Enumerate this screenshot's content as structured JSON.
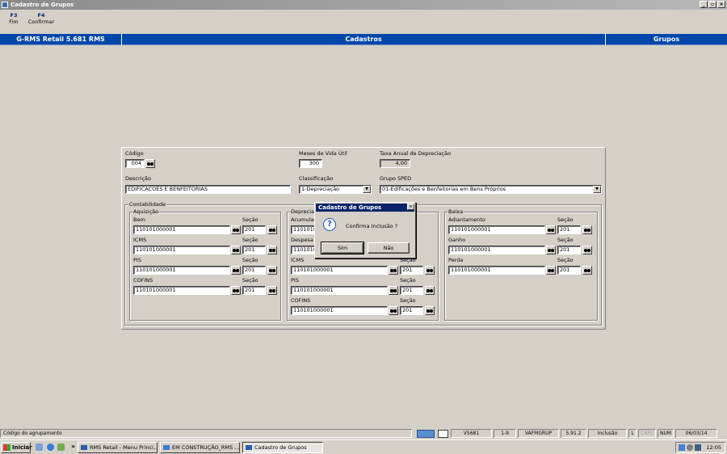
{
  "window": {
    "title": "Cadastro de Grupos",
    "controls": [
      "_",
      "▫",
      "×"
    ]
  },
  "fkeys": [
    {
      "key": "F3",
      "label": "Fim"
    },
    {
      "key": "F4",
      "label": "Confirmar"
    }
  ],
  "header": {
    "app": "G-RMS Retail 5.681 RMS",
    "module": "Cadastros",
    "screen": "Grupos"
  },
  "form": {
    "codigo": {
      "label": "Código",
      "value": "004"
    },
    "meses": {
      "label": "Meses de Vida Útil",
      "value": "300"
    },
    "taxa": {
      "label": "Taxa Anual de Depreciação",
      "value": "4,00"
    },
    "descricao": {
      "label": "Descrição",
      "value": "EDIFICACOES E BENFEITORIAS"
    },
    "classificacao": {
      "label": "Classificação",
      "value": "1-Depreciação"
    },
    "grupo_sped": {
      "label": "Grupo SPED",
      "value": "01-Edificações e Benfeitorias em Bens Próprios"
    }
  },
  "contabilidade": {
    "title": "Contabilidade",
    "aquisicao": {
      "title": "Aquisição",
      "rows": [
        {
          "label": "Bem",
          "value": "110101000001",
          "secao_label": "Seção",
          "secao": "201"
        },
        {
          "label": "ICMS",
          "value": "110101000001",
          "secao_label": "Seção",
          "secao": "201"
        },
        {
          "label": "PIS",
          "value": "110101000001",
          "secao_label": "Seção",
          "secao": "201"
        },
        {
          "label": "COFINS",
          "value": "110101000001",
          "secao_label": "Seção",
          "secao": "201"
        }
      ]
    },
    "depreciacao": {
      "title": "Deprecia",
      "rows": [
        {
          "label": "Acumulad",
          "value": "11010100",
          "secao_label": "",
          "secao": ""
        },
        {
          "label": "Despesa",
          "value": "11010100",
          "secao_label": "",
          "secao": ""
        },
        {
          "label": "ICMS",
          "value": "110101000001",
          "secao_label": "Seção",
          "secao": "201"
        },
        {
          "label": "PIS",
          "value": "110101000001",
          "secao_label": "Seção",
          "secao": "201"
        },
        {
          "label": "COFINS",
          "value": "110101000001",
          "secao_label": "Seção",
          "secao": "201"
        }
      ]
    },
    "baixa": {
      "title": "Baixa",
      "rows": [
        {
          "label": "Adiantamento",
          "value": "110101000001",
          "secao_label": "Seção",
          "secao": "201"
        },
        {
          "label": "Ganho",
          "value": "110101000001",
          "secao_label": "Seção",
          "secao": "201"
        },
        {
          "label": "Perda",
          "value": "110101000001",
          "secao_label": "Seção",
          "secao": "201"
        }
      ]
    }
  },
  "dialog": {
    "title": "Cadastro de Grupos",
    "close": "×",
    "message": "Confirma Inclusão ?",
    "icon": "?",
    "yes": "Sim",
    "no": "Não"
  },
  "statusbar": {
    "hint": "Código do agrupamento",
    "cells": [
      "V5681",
      "1-9",
      "VAFMGRUP",
      "5.91.2",
      "Inclusão",
      "L",
      "CAPS",
      "NUM",
      "06/03/14"
    ]
  },
  "taskbar": {
    "start": "Iniciar",
    "chevron": "»",
    "items": [
      "RMS Retail - Menu Princi...",
      "EM CONSTRUÇÃO_RMS ...",
      "Cadastro de Grupos"
    ],
    "clock": "12:05"
  }
}
